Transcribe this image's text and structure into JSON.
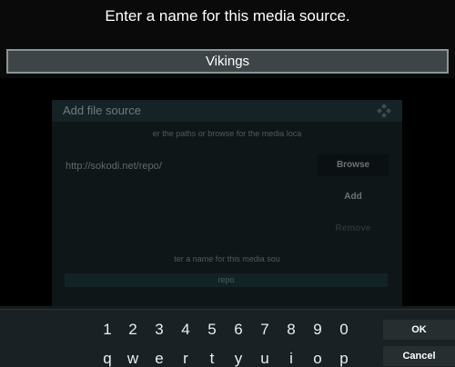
{
  "keyboard": {
    "heading": "Enter a name for this media source.",
    "input_value": "Vikings",
    "number_keys": [
      "1",
      "2",
      "3",
      "4",
      "5",
      "6",
      "7",
      "8",
      "9",
      "0"
    ],
    "letter_keys": [
      "q",
      "w",
      "e",
      "r",
      "t",
      "y",
      "u",
      "i",
      "o",
      "p"
    ],
    "ok_label": "OK",
    "cancel_label": "Cancel"
  },
  "background_dialog": {
    "title": "Add file source",
    "instructions": "er the paths or browse for the media loca",
    "path": "http://sokodi.net/repo/",
    "browse_label": "Browse",
    "add_label": "Add",
    "remove_label": "Remove",
    "name_label": "ter a name for this media sou",
    "name_value": "repo"
  },
  "colors": {
    "overlay_bg": "#000000",
    "input_bg": "#3d4547",
    "input_border": "#8a9598",
    "keyboard_bg": "#1a2124",
    "button_bg": "#262e30"
  }
}
